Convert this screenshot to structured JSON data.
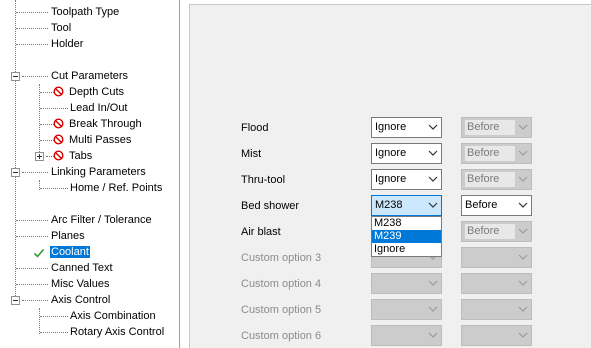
{
  "tree": {
    "toolpath_type": "Toolpath Type",
    "tool": "Tool",
    "holder": "Holder",
    "cut_parameters": "Cut Parameters",
    "depth_cuts": "Depth Cuts",
    "lead_in_out": "Lead In/Out",
    "break_through": "Break Through",
    "multi_passes": "Multi Passes",
    "tabs": "Tabs",
    "linking_parameters": "Linking Parameters",
    "home_ref_points": "Home / Ref. Points",
    "arc_filter": "Arc Filter / Tolerance",
    "planes": "Planes",
    "coolant": "Coolant",
    "canned_text": "Canned Text",
    "misc_values": "Misc Values",
    "axis_control": "Axis Control",
    "axis_combination": "Axis Combination",
    "rotary_axis_control": "Rotary Axis Control"
  },
  "coolant": {
    "rows": [
      {
        "label": "Flood",
        "value": "Ignore",
        "when": "Before"
      },
      {
        "label": "Mist",
        "value": "Ignore",
        "when": "Before"
      },
      {
        "label": "Thru-tool",
        "value": "Ignore",
        "when": "Before"
      },
      {
        "label": "Bed shower",
        "value": "M238",
        "when": "Before"
      },
      {
        "label": "Air blast",
        "value": "",
        "when": "Before"
      },
      {
        "label": "Custom option 3",
        "value": "",
        "when": ""
      },
      {
        "label": "Custom option 4",
        "value": "",
        "when": ""
      },
      {
        "label": "Custom option 5",
        "value": "",
        "when": ""
      },
      {
        "label": "Custom option 6",
        "value": "",
        "when": ""
      }
    ],
    "dropdown_options": [
      "M238",
      "M239",
      "Ignore"
    ],
    "dropdown_highlighted": "M239"
  },
  "colors": {
    "selection": "#0078d7",
    "panel_bg": "#f0f0f0",
    "check": "#2f9a2f",
    "no_icon": "#d40000"
  }
}
